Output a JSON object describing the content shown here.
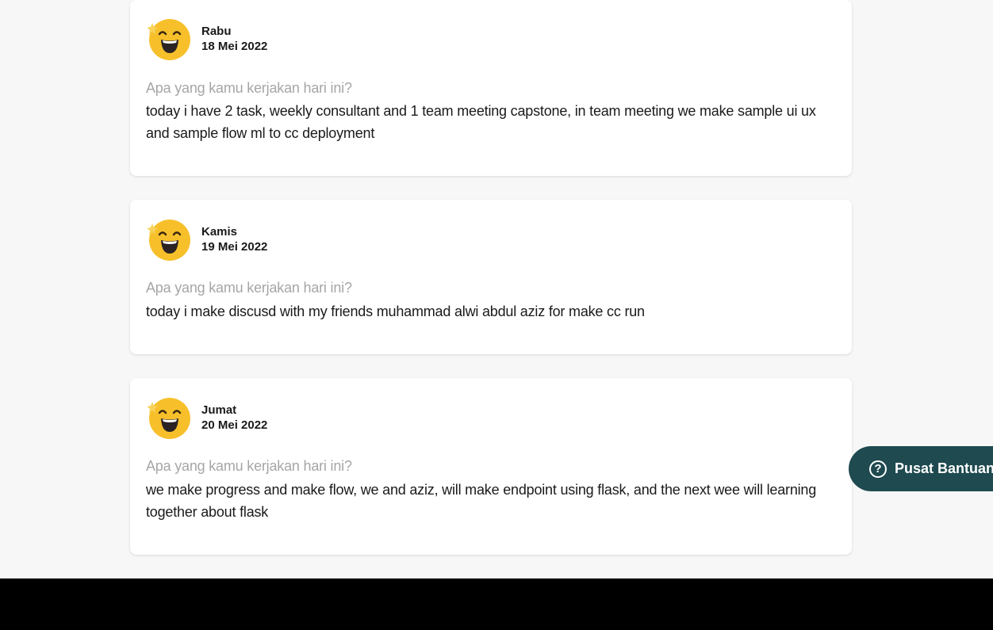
{
  "entries": [
    {
      "day": "Rabu",
      "date": "18 Mei 2022",
      "question": "Apa yang kamu kerjakan hari ini?",
      "answer": "today i have 2 task, weekly consultant and 1 team meeting capstone, in team meeting we make sample ui ux and sample flow ml to cc deployment"
    },
    {
      "day": "Kamis",
      "date": "19 Mei 2022",
      "question": "Apa yang kamu kerjakan hari ini?",
      "answer": "today i make discusd with my friends muhammad alwi abdul aziz for make cc run"
    },
    {
      "day": "Jumat",
      "date": "20 Mei 2022",
      "question": "Apa yang kamu kerjakan hari ini?",
      "answer": "we make progress and make flow, we and aziz, will make endpoint using flask, and the next wee will learning together about flask"
    }
  ],
  "help_button": {
    "label": "Pusat Bantuan",
    "icon": "question-circle-icon"
  },
  "colors": {
    "help_bg": "#1e4a50",
    "question_text": "#a6a6a6",
    "page_bg": "#f7f7f7"
  },
  "mood_icon": "happy-emoji-icon"
}
